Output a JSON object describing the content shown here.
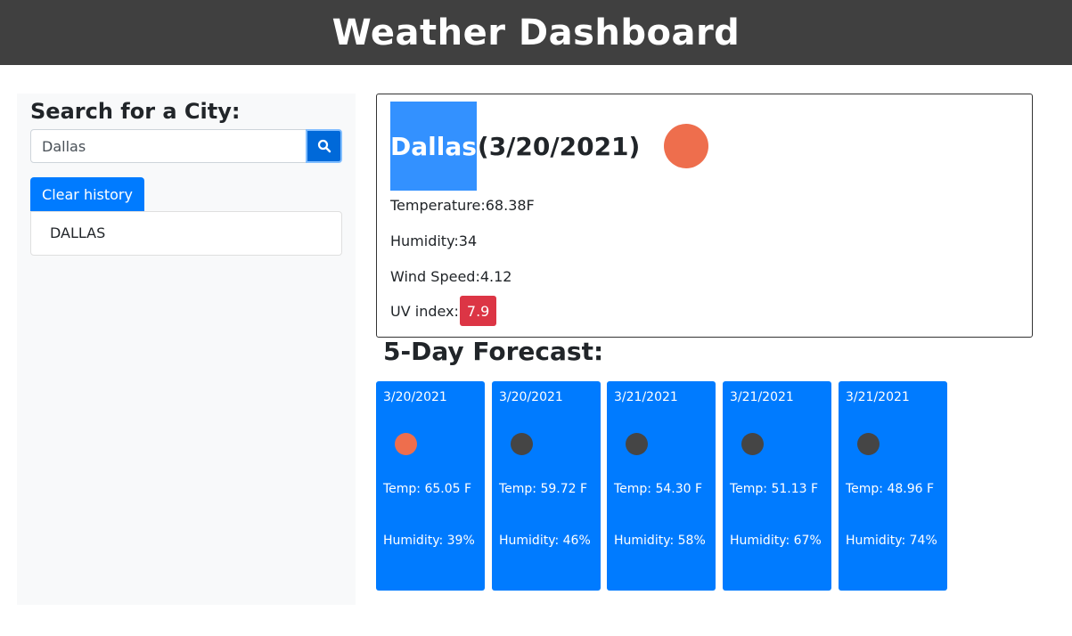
{
  "header": {
    "title": "Weather Dashboard"
  },
  "sidebar": {
    "search_label": "Search for a City:",
    "search_value": "Dallas",
    "search_icon": "search-icon",
    "clear_label": "Clear history",
    "history": [
      "DALLAS"
    ]
  },
  "current": {
    "city": "Dallas",
    "date": "(3/20/2021)",
    "icon_color": "#ee6e4d",
    "temperature": "Temperature:68.38F",
    "humidity": "Humidity:34",
    "wind": "Wind Speed:4.12",
    "uv_label": "UV index:",
    "uv_value": "7.9",
    "uv_color": "#dc3545"
  },
  "forecast": {
    "title": "5-Day Forecast:",
    "days": [
      {
        "date": "3/20/2021",
        "icon_color": "#ee6e4d",
        "temp": "Temp: 65.05 F",
        "humidity": "Humidity: 39%"
      },
      {
        "date": "3/20/2021",
        "icon_color": "#454545",
        "temp": "Temp: 59.72 F",
        "humidity": "Humidity: 46%"
      },
      {
        "date": "3/21/2021",
        "icon_color": "#454545",
        "temp": "Temp: 54.30 F",
        "humidity": "Humidity: 58%"
      },
      {
        "date": "3/21/2021",
        "icon_color": "#454545",
        "temp": "Temp: 51.13 F",
        "humidity": "Humidity: 67%"
      },
      {
        "date": "3/21/2021",
        "icon_color": "#454545",
        "temp": "Temp: 48.96 F",
        "humidity": "Humidity: 74%"
      }
    ]
  },
  "colors": {
    "header_bg": "#404040",
    "primary": "#007bff",
    "sidebar_bg": "#f8f9fa"
  }
}
